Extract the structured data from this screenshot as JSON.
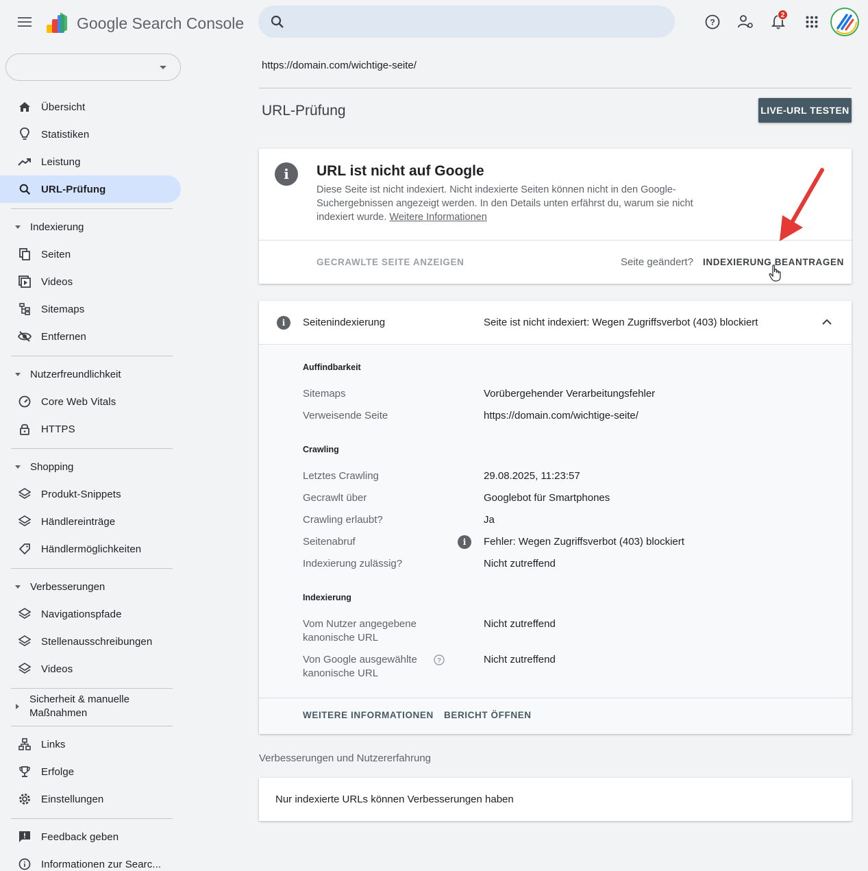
{
  "header": {
    "brand": "Google Search Console",
    "search_placeholder": "",
    "notification_count": "2"
  },
  "sidebar": {
    "property_selected": "",
    "top_items": [
      {
        "label": "Übersicht",
        "icon": "home-icon"
      },
      {
        "label": "Statistiken",
        "icon": "lightbulb-icon"
      },
      {
        "label": "Leistung",
        "icon": "trending-icon"
      },
      {
        "label": "URL-Prüfung",
        "icon": "search-icon",
        "active": true
      }
    ],
    "sections": [
      {
        "label": "Indexierung",
        "items": [
          "Seiten",
          "Videos",
          "Sitemaps",
          "Entfernen"
        ]
      },
      {
        "label": "Nutzerfreundlichkeit",
        "items": [
          "Core Web Vitals",
          "HTTPS"
        ]
      },
      {
        "label": "Shopping",
        "items": [
          "Produkt-Snippets",
          "Händlereinträge",
          "Händlermöglichkeiten"
        ]
      },
      {
        "label": "Verbesserungen",
        "items": [
          "Navigationspfade",
          "Stellenausschreibungen",
          "Videos"
        ]
      },
      {
        "label": "Sicherheit & manuelle Maßnahmen",
        "label_line1": "Sicherheit & manuelle",
        "label_line2": "Maßnahmen"
      }
    ],
    "bottom_items": [
      "Links",
      "Erfolge",
      "Einstellungen"
    ],
    "footer_items": [
      "Feedback geben",
      "Informationen zur Searc..."
    ]
  },
  "main": {
    "inspected_url": "https://domain.com/wichtige-seite/",
    "page_title": "URL-Prüfung",
    "live_test_label": "LIVE-URL TESTEN",
    "status_card": {
      "title": "URL ist nicht auf Google",
      "description": "Diese Seite ist nicht indexiert. Nicht indexierte Seiten können nicht in den Google-Suchergebnissen angezeigt werden. In den Details unten erfährst du, warum sie nicht indexiert wurde.",
      "more_link": "Weitere Informationen",
      "view_crawled_label": "GECRAWLTE SEITE ANZEIGEN",
      "page_changed_label": "Seite geändert?",
      "request_indexing_label": "INDEXIERUNG BEANTRAGEN"
    },
    "indexing_card": {
      "title": "Seitenindexierung",
      "status": "Seite ist nicht indexiert: Wegen Zugriffsverbot (403) blockiert",
      "groups": {
        "discovery": {
          "label": "Auffindbarkeit",
          "rows": [
            {
              "label": "Sitemaps",
              "value": "Vorübergehender Verarbeitungsfehler"
            },
            {
              "label": "Verweisende Seite",
              "value": "https://domain.com/wichtige-seite/"
            }
          ]
        },
        "crawling": {
          "label": "Crawling",
          "rows": [
            {
              "label": "Letztes Crawling",
              "value": "29.08.2025, 11:23:57"
            },
            {
              "label": "Gecrawlt über",
              "value": "Googlebot für Smartphones"
            },
            {
              "label": "Crawling erlaubt?",
              "value": "Ja"
            },
            {
              "label": "Seitenabruf",
              "value": "Fehler: Wegen Zugriffsverbot (403) blockiert"
            },
            {
              "label": "Indexierung zulässig?",
              "value": "Nicht zutreffend"
            }
          ]
        },
        "indexing": {
          "label": "Indexierung",
          "rows": [
            {
              "label_line1": "Vom Nutzer angegebene",
              "label_line2": "kanonische URL",
              "value": "Nicht zutreffend"
            },
            {
              "label_line1": "Von Google ausgewählte",
              "label_line2": "kanonische URL",
              "value": "Nicht zutreffend"
            }
          ]
        }
      },
      "more_info_label": "WEITERE INFORMATIONEN",
      "open_report_label": "BERICHT ÖFFNEN"
    },
    "enhancements_caption": "Verbesserungen und Nutzererfahrung",
    "enhancements_text": "Nur indexierte URLs können Verbesserungen haben"
  },
  "colors": {
    "accent_active": "#d3e3fd",
    "button_dark": "#455a64",
    "arrow_red": "#e53935",
    "badge_red": "#d93025"
  }
}
